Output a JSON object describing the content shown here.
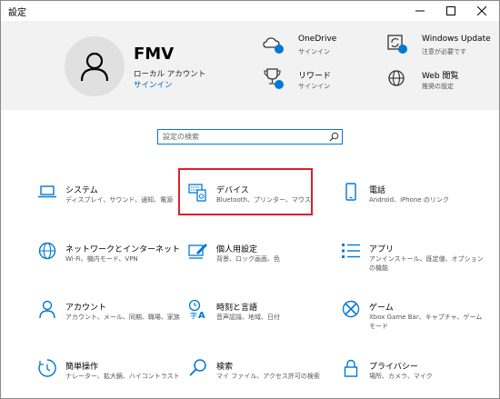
{
  "window": {
    "title": "設定"
  },
  "user": {
    "name": "FMV",
    "account_type": "ローカル アカウント",
    "signin_link": "サインイン"
  },
  "services": [
    {
      "name": "OneDrive",
      "desc": "サインイン"
    },
    {
      "name": "Windows Update",
      "desc": "注意が必要です"
    },
    {
      "name": "リワード",
      "desc": "サインイン"
    },
    {
      "name": "Web 閲覧",
      "desc": "推奨の設定"
    }
  ],
  "search": {
    "placeholder": "設定の検索"
  },
  "tiles": [
    {
      "name": "システム",
      "desc": "ディスプレイ、サウンド、通知、電源"
    },
    {
      "name": "デバイス",
      "desc": "Bluetooth、プリンター、マウス"
    },
    {
      "name": "電話",
      "desc": "Android、iPhone のリンク"
    },
    {
      "name": "ネットワークとインターネット",
      "desc": "Wi-Fi、機内モード、VPN"
    },
    {
      "name": "個人用設定",
      "desc": "背景、ロック画面、色"
    },
    {
      "name": "アプリ",
      "desc": "アンインストール、既定値、オプションの機能"
    },
    {
      "name": "アカウント",
      "desc": "アカウント、メール、同期、職場、家族"
    },
    {
      "name": "時刻と言語",
      "desc": "音声認識、地域、日付"
    },
    {
      "name": "ゲーム",
      "desc": "Xbox Game Bar、キャプチャ、ゲーム モード"
    },
    {
      "name": "簡単操作",
      "desc": "ナレーター、拡大鏡、ハイコントラスト"
    },
    {
      "name": "検索",
      "desc": "マイ ファイル、アクセス許可の検索"
    },
    {
      "name": "プライバシー",
      "desc": "場所、カメラ、マイク"
    }
  ],
  "colors": {
    "accent": "#0078d7",
    "link": "#0063b1",
    "highlight": "#e01d2b",
    "header_bg": "#f2f2f2"
  }
}
